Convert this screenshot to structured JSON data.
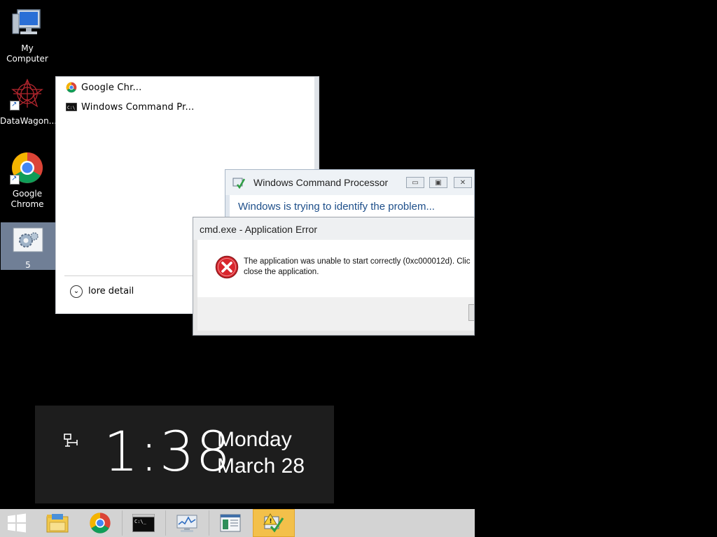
{
  "desktop": {
    "icons": [
      {
        "name": "my-computer",
        "label": "My Computer",
        "icon": "computer-icon"
      },
      {
        "name": "datawagon",
        "label": "DataWagon...",
        "icon": "datawagon-app-icon"
      },
      {
        "name": "google-chrome",
        "label": "Google Chrome",
        "label_line1": "Google",
        "label_line2": "Chrome",
        "icon": "chrome-icon"
      },
      {
        "name": "settings-shortcut",
        "label": "5",
        "icon": "gear-settings-icon",
        "selected": true
      }
    ]
  },
  "jump_list": {
    "items": [
      {
        "label": "Google Chr...",
        "icon": "chrome-icon"
      },
      {
        "label": "Windows Command Pr...",
        "icon": "command-prompt-icon"
      }
    ],
    "more_detail": "lore detail"
  },
  "cmd_window": {
    "title": "Windows Command Processor",
    "message": "Windows is trying to identify the problem...",
    "buttons": [
      "minimize",
      "maximize",
      "close"
    ]
  },
  "error_dialog": {
    "title": "cmd.exe - Application Error",
    "message_line1": "The application was unable to start correctly (0xc000012d). Clic",
    "message_line2": "close the application.",
    "icon": "error-x-icon"
  },
  "clock": {
    "time": "1:38",
    "day": "Monday",
    "date": "March 28",
    "icon": "network-icon"
  },
  "taskbar": {
    "items": [
      {
        "name": "start",
        "icon": "windows-logo-icon"
      },
      {
        "name": "file-explorer",
        "icon": "folder-icon"
      },
      {
        "name": "chrome",
        "icon": "chrome-icon"
      },
      {
        "name": "command-prompt",
        "icon": "command-prompt-icon"
      },
      {
        "name": "performance-monitor",
        "icon": "performance-monitor-icon"
      },
      {
        "name": "event-viewer",
        "icon": "event-viewer-icon"
      },
      {
        "name": "action-center",
        "icon": "action-center-warning-icon",
        "active": true
      }
    ]
  },
  "colors": {
    "desktop_bg": "#000000",
    "taskbar_bg": "#d3d3d3",
    "active_task": "#f3c04a",
    "message_blue": "#1e4f8a",
    "error_red": "#d9262d"
  }
}
